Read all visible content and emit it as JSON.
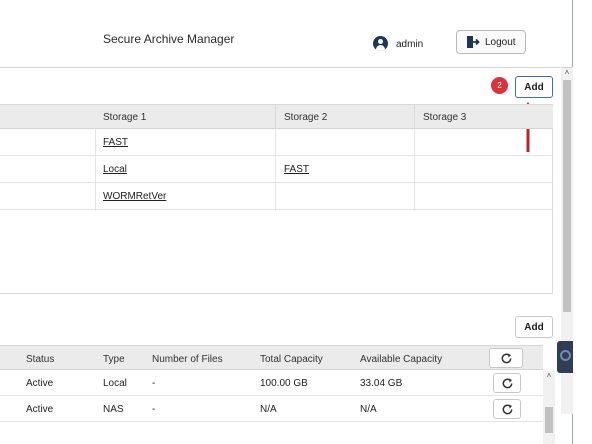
{
  "header": {
    "title": "Secure Archive Manager",
    "user": "admin",
    "logout_label": "Logout"
  },
  "badge": "2",
  "add_top_label": "Add",
  "storage_table": {
    "columns": [
      "Storage 1",
      "Storage 2",
      "Storage 3"
    ],
    "rows": [
      [
        "FAST",
        "",
        ""
      ],
      [
        "Local",
        "FAST",
        ""
      ],
      [
        "WORMRetVer",
        "",
        ""
      ]
    ]
  },
  "add_bottom_label": "Add",
  "volume_table": {
    "columns": [
      "Status",
      "Type",
      "Number of Files",
      "Total Capacity",
      "Available Capacity"
    ],
    "rows": [
      [
        "Active",
        "Local",
        "-",
        "100.00 GB",
        "33.04 GB"
      ],
      [
        "Active",
        "NAS",
        "-",
        "N/A",
        "N/A"
      ]
    ]
  },
  "colors": {
    "accent": "#3f6fb3",
    "badge": "#d9343b",
    "arrow": "#b3262c",
    "header_row": "#ecebeb"
  }
}
